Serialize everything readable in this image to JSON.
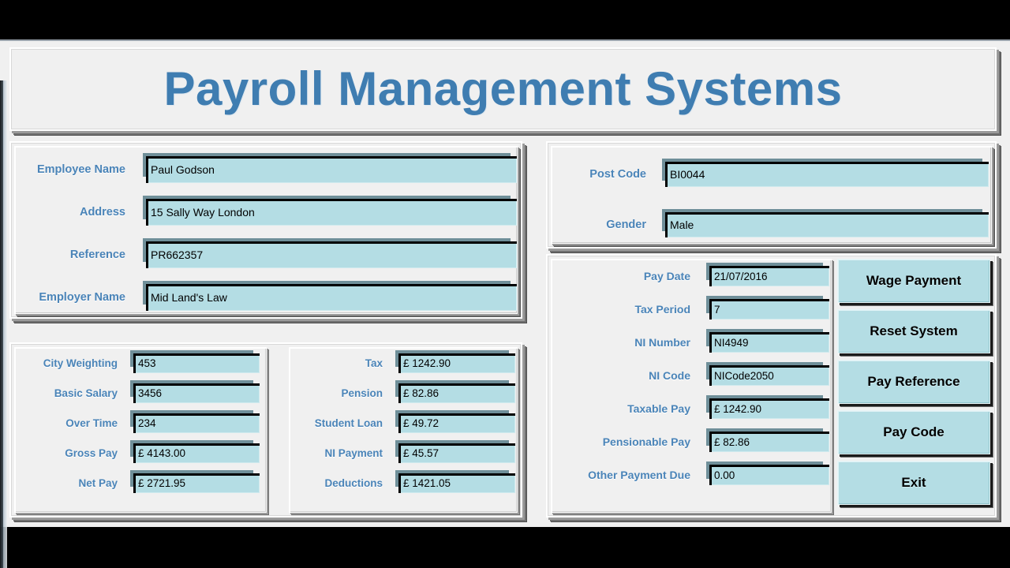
{
  "app": {
    "title": "Payroll Management Systems"
  },
  "employee_panel": {
    "fields": [
      {
        "label": "Employee Name",
        "value": "Paul Godson"
      },
      {
        "label": "Address",
        "value": "15 Sally Way London"
      },
      {
        "label": "Reference",
        "value": "PR662357"
      },
      {
        "label": "Employer Name",
        "value": "Mid Land's Law"
      }
    ]
  },
  "earnings_panel": {
    "fields": [
      {
        "label": "City Weighting",
        "value": "453"
      },
      {
        "label": "Basic Salary",
        "value": "3456"
      },
      {
        "label": "Over Time",
        "value": "234"
      },
      {
        "label": "Gross Pay",
        "value": "£ 4143.00"
      },
      {
        "label": "Net Pay",
        "value": "£ 2721.95"
      }
    ]
  },
  "deductions_panel": {
    "fields": [
      {
        "label": "Tax",
        "value": "£ 1242.90"
      },
      {
        "label": "Pension",
        "value": "£ 82.86"
      },
      {
        "label": "Student Loan",
        "value": "£ 49.72"
      },
      {
        "label": "NI Payment",
        "value": "£ 45.57"
      },
      {
        "label": "Deductions",
        "value": "£ 1421.05"
      }
    ]
  },
  "postcode_panel": {
    "fields": [
      {
        "label": "Post Code",
        "value": "BI0044"
      },
      {
        "label": "Gender",
        "value": "Male"
      }
    ]
  },
  "details_panel": {
    "fields": [
      {
        "label": "Pay Date",
        "value": "21/07/2016"
      },
      {
        "label": "Tax Period",
        "value": "7"
      },
      {
        "label": "NI Number",
        "value": "NI4949"
      },
      {
        "label": "NI Code",
        "value": "NICode2050"
      },
      {
        "label": "Taxable Pay",
        "value": "£ 1242.90"
      },
      {
        "label": "Pensionable Pay",
        "value": "£ 82.86"
      },
      {
        "label": "Other Payment Due",
        "value": "0.00"
      }
    ]
  },
  "buttons": [
    {
      "label": "Wage Payment"
    },
    {
      "label": "Reset System"
    },
    {
      "label": "Pay Reference"
    },
    {
      "label": "Pay Code"
    },
    {
      "label": "Exit"
    }
  ],
  "colors": {
    "title_blue": "#3f7db1",
    "label_blue": "#4a84b8",
    "field_fill": "#b4dde4",
    "panel_face": "#f0f0f0",
    "bevel_shadow": "#6f6f6f"
  }
}
